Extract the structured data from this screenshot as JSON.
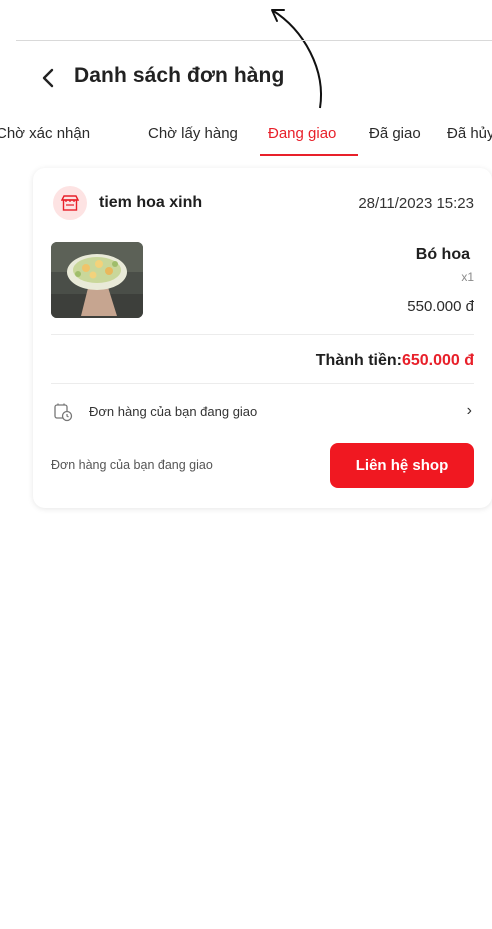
{
  "header": {
    "title": "Danh sách đơn hàng",
    "back_icon": "chevron-left-icon"
  },
  "tabs": [
    {
      "label": "Chờ xác nhận",
      "active": false
    },
    {
      "label": "Chờ lấy hàng",
      "active": false
    },
    {
      "label": "Đang giao",
      "active": true
    },
    {
      "label": "Đã giao",
      "active": false
    },
    {
      "label": "Đã hủy",
      "active": false
    }
  ],
  "order": {
    "shop_name": "tiem hoa xinh",
    "shop_icon": "store-icon",
    "date": "28/11/2023 15:23",
    "product": {
      "name": "Bó hoa",
      "quantity": "x1",
      "price": "550.000 đ"
    },
    "total_label": "Thành tiền:",
    "total_value": "650.000 đ",
    "status_text": "Đơn hàng của bạn đang giao",
    "status_icon": "delivery-status-icon",
    "note": "Đơn hàng của bạn đang giao",
    "contact_button": "Liên hệ shop"
  },
  "colors": {
    "accent": "#e8202a",
    "button": "#f01821",
    "avatar_bg": "#fde3e3"
  }
}
